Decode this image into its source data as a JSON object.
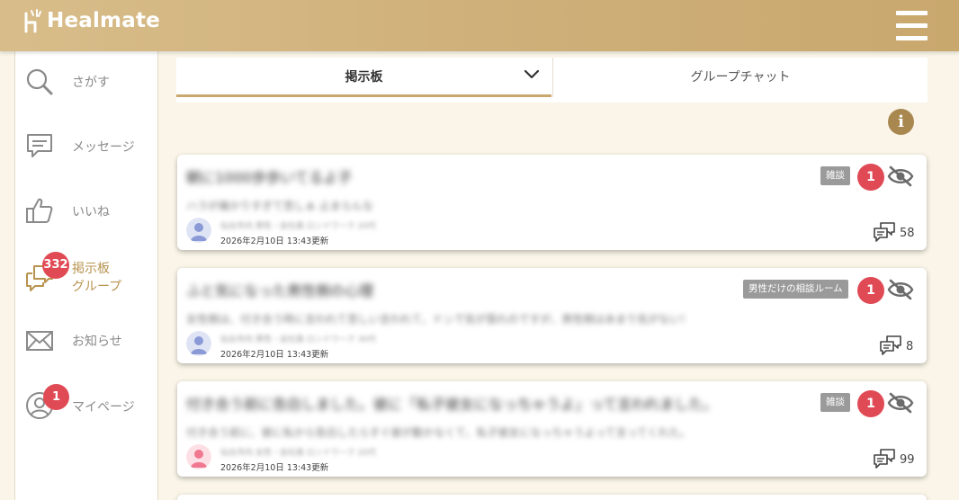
{
  "header": {
    "logo_text": "Healmate"
  },
  "sidebar": {
    "items": [
      {
        "label": "さがす",
        "icon": "search-icon"
      },
      {
        "label": "メッセージ",
        "icon": "message-icon"
      },
      {
        "label": "いいね",
        "icon": "thumbs-up-icon"
      },
      {
        "label": "掲示板\nグループ",
        "label_line1": "掲示板",
        "label_line2": "グループ",
        "icon": "board-icon",
        "badge": "332",
        "active": true
      },
      {
        "label": "お知らせ",
        "icon": "mail-icon"
      },
      {
        "label": "マイページ",
        "icon": "user-icon",
        "badge": "1"
      }
    ]
  },
  "tabs": {
    "board_label": "掲示板",
    "group_chat_label": "グループチャット"
  },
  "posts": [
    {
      "title": "朝に1000歩歩いてるよ子",
      "snippet": "ハラが痛かりすぎて悲しぁ 止まらんな",
      "author": "仙台市内 男性・会社員 ロンドワーク 20代",
      "date": "2026年2月10日 13:43更新",
      "tag": "雑談",
      "badge": "1",
      "comments": "58",
      "avatar_color": "#8b9ad6"
    },
    {
      "title": "ふと気になった男性側の心理",
      "snippet": "女性側は、付き合う時に言われて悲しい言われて、ドンで気が張れのですが、男性側はあまり気がない！",
      "author": "仙台市内 男性・会社員 ロンドワーク 30代",
      "date": "2026年2月10日 13:43更新",
      "tag": "男性だけの相談ルーム",
      "badge": "1",
      "comments": "8",
      "avatar_color": "#8b9ad6"
    },
    {
      "title": "付き合う前に告白しました。彼に「私子彼女になっちゃうよ」って言われました。",
      "snippet": "付き合う前に、彼に私から告白したらすぐ彼が動かなくて、私子彼女になっちゃうよって言ってくれた。",
      "author": "仙台市内 女性・会社員 ロンドワーク 20代",
      "date": "2026年2月10日 13:43更新",
      "tag": "雑談",
      "badge": "1",
      "comments": "99",
      "avatar_color": "#f07890"
    }
  ],
  "colors": {
    "header_gradient_start": "#d8bd8a",
    "header_gradient_end": "#c9a86e",
    "accent": "#c9a86e",
    "badge_red": "#e04a55",
    "tag_gray": "#9a9a9a",
    "info_brown": "#a98850"
  },
  "icons": {
    "info": "i"
  }
}
